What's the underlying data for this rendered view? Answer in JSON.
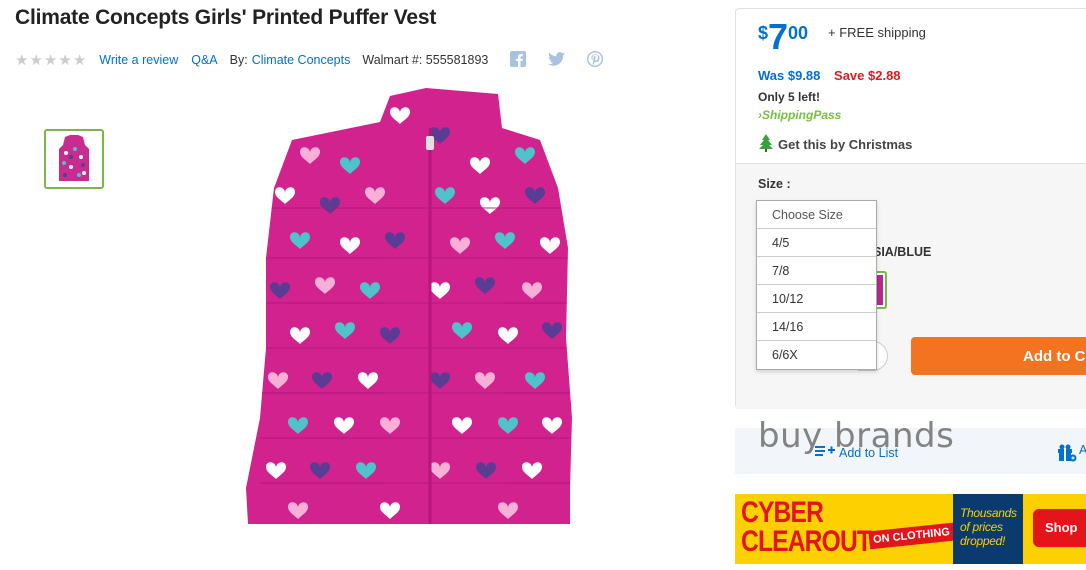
{
  "product": {
    "title": "Climate Concepts Girls' Printed Puffer Vest",
    "rating_stars": 5,
    "write_review": "Write a review",
    "qa": "Q&A",
    "by_label": "By:",
    "brand": "Climate Concepts",
    "walmart_number": "Walmart #: 555581893"
  },
  "social": {
    "icons": [
      "facebook-icon",
      "twitter-icon",
      "pinterest-icon"
    ],
    "color": "#a9c2dd"
  },
  "price": {
    "dollar_sign": "$",
    "whole": "7",
    "cents": "00",
    "shipping": "+ FREE shipping",
    "was": "Was $9.88",
    "save": "Save $2.88",
    "only_left": "Only 5 left!",
    "shippingpass": "ShippingPass",
    "christmas": "Get this by Christmas"
  },
  "options": {
    "size_label": "Size :",
    "color_label_partial": "SIA/BLUE",
    "size_dropdown": {
      "placeholder": "Choose Size",
      "options": [
        "4/5",
        "7/8",
        "10/12",
        "14/16",
        "6/6X"
      ]
    }
  },
  "actions": {
    "add_to_cart": "Add to Ca",
    "add_to_list": "Add to List",
    "gift_partial": "A"
  },
  "watermark": "buy  brands",
  "banner": {
    "line1": "CYBER",
    "line2": "CLEAROUT",
    "on_clothing": "ON CLOTHING",
    "thousands": "Thousands of prices dropped!",
    "shop": "Shop"
  },
  "colors": {
    "accent_blue": "#0071ce",
    "save_red": "#de1c24",
    "cart_orange": "#f47321",
    "green": "#76c043",
    "banner_yellow": "#fcd001"
  }
}
